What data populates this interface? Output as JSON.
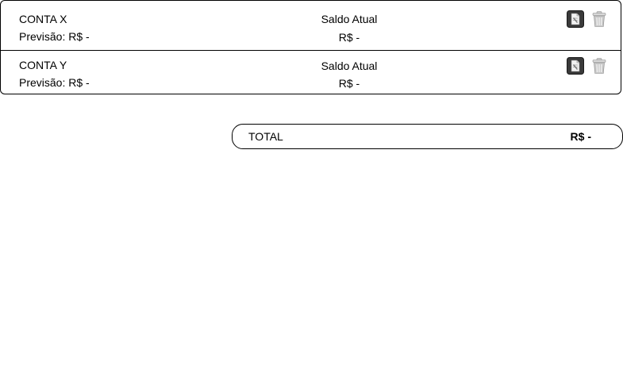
{
  "accounts": [
    {
      "name": "CONTA X",
      "forecast": "Previsão: R$ -",
      "balance_label": "Saldo Atual",
      "balance_value": "R$ -",
      "actions": {
        "edit_icon": "edit-document-icon",
        "delete_icon": "trash-can-icon"
      }
    },
    {
      "name": "CONTA Y",
      "forecast": "Previsão: R$ -",
      "balance_label": "Saldo Atual",
      "balance_value": "R$ -",
      "actions": {
        "edit_icon": "edit-document-icon",
        "delete_icon": "trash-can-icon"
      }
    }
  ],
  "total": {
    "label": "TOTAL",
    "value": "R$ -"
  },
  "colors": {
    "border": "#000000",
    "edit_icon_bg": "#3a3a3a",
    "trash_icon": "#bfbfbf"
  }
}
